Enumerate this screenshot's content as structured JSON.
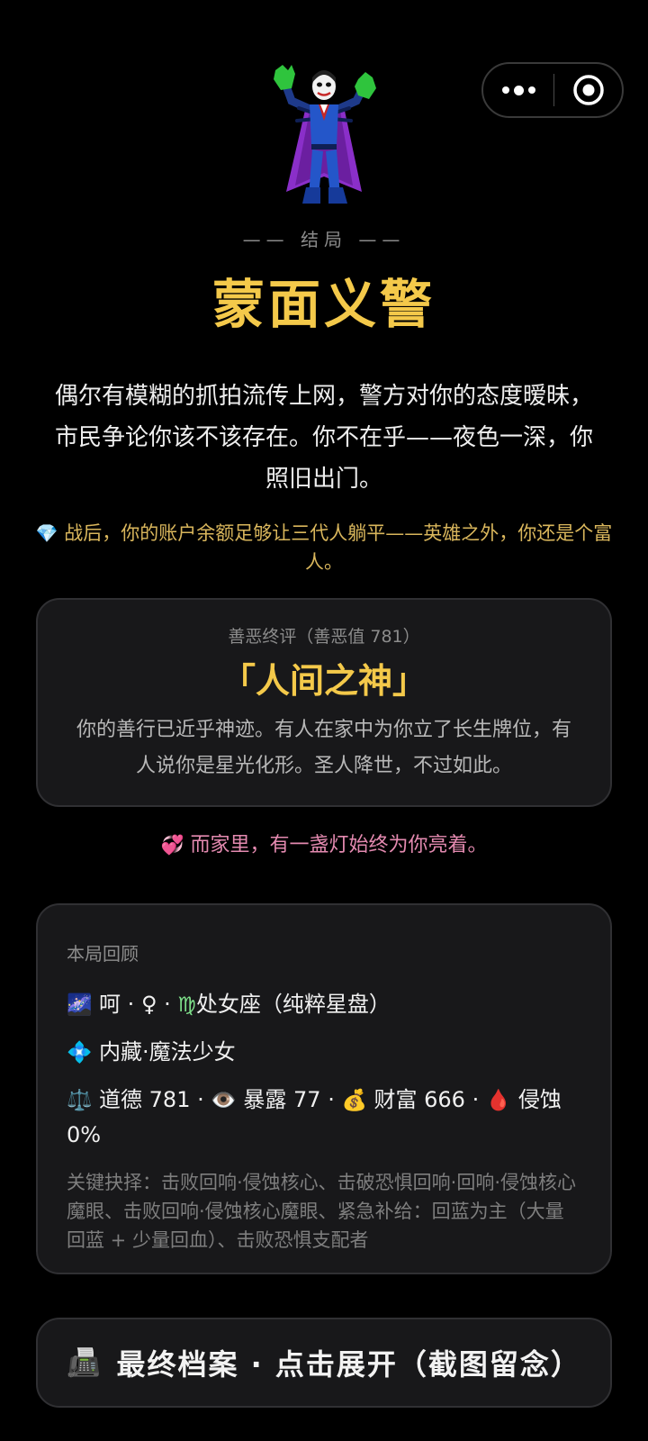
{
  "ending": {
    "label": "—— 结局 ——",
    "title": "蒙面义警",
    "description": "偶尔有模糊的抓拍流传上网，警方对你的态度暧昧，市民争论你该不该存在。你不在乎——夜色一深，你照旧出门。",
    "bonus_icon": "💎",
    "bonus_text": "战后，你的账户余额足够让三代人躺平——英雄之外，你还是个富人。",
    "hero_icon": "supervillain-icon"
  },
  "verdict": {
    "label": "善恶终评（善恶值 781）",
    "title": "「人间之神」",
    "description": "你的善行已近乎神迹。有人在家中为你立了长生牌位，有人说你是星光化形。圣人降世，不过如此。"
  },
  "family": {
    "icon": "💞",
    "text": "而家里，有一盏灯始终为你亮着。"
  },
  "review": {
    "label": "本局回顾",
    "line1": {
      "icon": "🌌",
      "name": "呵",
      "gender": "♀",
      "zodiac_icon": "♍",
      "zodiac": "处女座（纯粹星盘）"
    },
    "line2": {
      "icon": "💠",
      "text": "内藏·魔法少女"
    },
    "stats": {
      "morality_icon": "⚖️",
      "morality": "道德 781",
      "exposure_icon": "👁️",
      "exposure": "暴露 77",
      "wealth_icon": "💰",
      "wealth": "财富 666",
      "erosion_icon": "🩸",
      "erosion": "侵蚀 0%"
    },
    "key_choices": "关键抉择：击败回响·侵蚀核心、击破恐惧回响·回响·侵蚀核心魔眼、击败回响·侵蚀核心魔眼、紧急补给：回蓝为主（大量回蓝 + 少量回血）、击败恐惧支配者"
  },
  "archive_button": {
    "icon": "📠",
    "label": "最终档案 · 点击展开（截图留念）"
  },
  "capsule": {
    "more_icon": "more-dots-icon",
    "close_icon": "target-circle-icon"
  }
}
